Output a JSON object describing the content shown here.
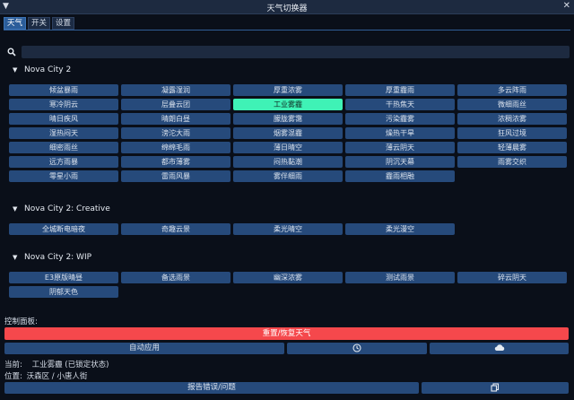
{
  "window": {
    "title": "天气切换器",
    "collapse_glyph": "▼",
    "close_glyph": "✕"
  },
  "tabs": [
    {
      "label": "天气",
      "active": true
    },
    {
      "label": "开关",
      "active": false
    },
    {
      "label": "设置",
      "active": false
    }
  ],
  "search": {
    "value": "",
    "placeholder": "",
    "icon": "search-icon"
  },
  "groups": [
    {
      "name": "Nova City 2",
      "expanded": true,
      "items": [
        "倾盆暴雨",
        "凝露湿润",
        "厚重浓雾",
        "厚重霾雨",
        "多云阵雨",
        "寒冷阴云",
        "层叠云团",
        "工业雾霾",
        "干热焦天",
        "微细雨丝",
        "晴日疾风",
        "晴朗白昼",
        "朦胧雾霭",
        "污染霾雾",
        "浓稠浓雾",
        "湿热闷天",
        "滂沱大雨",
        "烟雾混霾",
        "燥热干旱",
        "狂风过境",
        "细密雨丝",
        "绵绵毛雨",
        "薄日晴空",
        "薄云阴天",
        "轻薄晨雾",
        "远方雨暴",
        "都市薄雾",
        "闷热黏潮",
        "阴沉天幕",
        "雨雾交织",
        "零星小雨",
        "雷雨风暴",
        "雾伴细雨",
        "霾雨相融"
      ],
      "active_item": "工业雾霾"
    },
    {
      "name": "Nova City 2: Creative",
      "expanded": true,
      "items": [
        "全城断电暗夜",
        "奇趣云景",
        "柔光晴空",
        "柔光漫空"
      ]
    },
    {
      "name": "Nova City 2: WIP",
      "expanded": true,
      "items": [
        "E3原版晴昼",
        "备选雨景",
        "幽深浓雾",
        "测试雨景",
        "碎云阴天",
        "阴郁天色"
      ]
    }
  ],
  "control_panel": {
    "label": "控制面板:",
    "reset_label": "重置/恢复天气",
    "auto_apply_label": "自动应用",
    "clock_icon": "clock-icon",
    "cloud_icon": "cloud-icon",
    "current_prefix": "当前:",
    "current_value": "工业雾霾 (已锁定状态)",
    "location_prefix": "位置:",
    "location_value": "沃森区 / 小唐人街",
    "report_label": "报告错误/问题",
    "copy_icon": "copy-icon"
  },
  "colors": {
    "background": "#0a0f19",
    "button": "#264a7b",
    "active_button": "#3ff2b6",
    "reset_button": "#f5484c",
    "tab_active": "#2b5d9a"
  }
}
